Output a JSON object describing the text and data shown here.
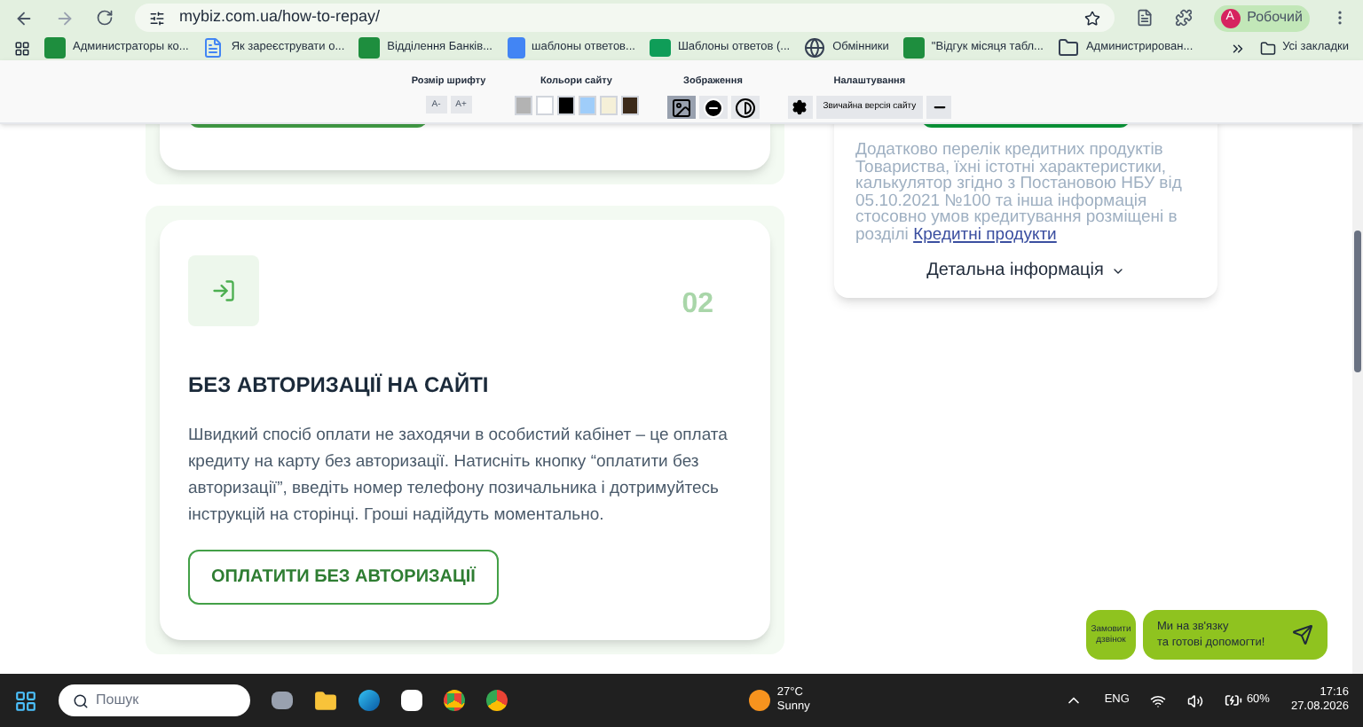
{
  "browser": {
    "url": "mybiz.com.ua/how-to-repay/",
    "profile": {
      "initial": "A",
      "name": "Робочий"
    },
    "bookmarks": [
      {
        "label": "Администраторы ко...",
        "kind": "sheet"
      },
      {
        "label": "Як зареєструвати о...",
        "kind": "doc"
      },
      {
        "label": "Відділення Банків...",
        "kind": "sheet"
      },
      {
        "label": "шаблоны ответов...",
        "kind": "docs"
      },
      {
        "label": "Шаблоны ответов (...",
        "kind": "form"
      },
      {
        "label": "Обмінники",
        "kind": "globe"
      },
      {
        "label": "\"Відгук місяця табл...",
        "kind": "sheet"
      },
      {
        "label": "Администрирован...",
        "kind": "folder"
      }
    ],
    "all_bookmarks": "Усі закладки"
  },
  "accessibility": {
    "groups": [
      {
        "title": "Розмір шрифту",
        "kind": "font",
        "buttons": [
          "A-",
          "A+"
        ]
      },
      {
        "title": "Кольори сайту",
        "kind": "colors",
        "swatches": [
          {
            "color": "#b3b3b3"
          },
          {
            "color": "#ffffff"
          },
          {
            "color": "#000000"
          },
          {
            "color": "#9fcdfa"
          },
          {
            "color": "#f5f0d8"
          },
          {
            "color": "#3b2a1a"
          }
        ]
      },
      {
        "title": "Зображення",
        "kind": "images",
        "buttons": [
          {
            "selected": true
          },
          {
            "selected": false
          },
          {
            "selected": false
          }
        ]
      },
      {
        "title": "Налаштування",
        "kind": "settings",
        "button": "Звичайна версія сайту"
      }
    ]
  },
  "card": {
    "number": "02",
    "title": "БЕЗ АВТОРИЗАЦІЇ НА САЙТІ",
    "text": "Швидкий спосіб оплати не заходячи в особистий кабінет – це оплата кредиту на карту без авторизації. Натисніть кнопку “оплатити без авторизації”, введіть номер телефону позичальника і дотримуйтесь інструкцій на сторінці. Гроші надійдуть моментально.",
    "button": "ОПЛАТИТИ БЕЗ АВТОРИЗАЦІЇ"
  },
  "side_card": {
    "text": "Додатково перелік кредитних продуктів Товариства, їхні істотні характеристики, калькулятор згідно з Постановою НБУ від 05.10.2021 №100 та інша інформація стосовно умов кредитування розміщені в розділі",
    "link": "Кредитні продукти",
    "details": "Детальна інформація"
  },
  "widgets": {
    "callback": "Замовити дзвінок",
    "chat": "Ми на зв'язку\nта готові допомогти!"
  },
  "taskbar": {
    "search_placeholder": "Пошук",
    "weather": {
      "temp": "27°C",
      "condition": "Sunny"
    },
    "language": "ENG",
    "battery": "60%",
    "time": "17:16",
    "date": "27.08.2026"
  }
}
